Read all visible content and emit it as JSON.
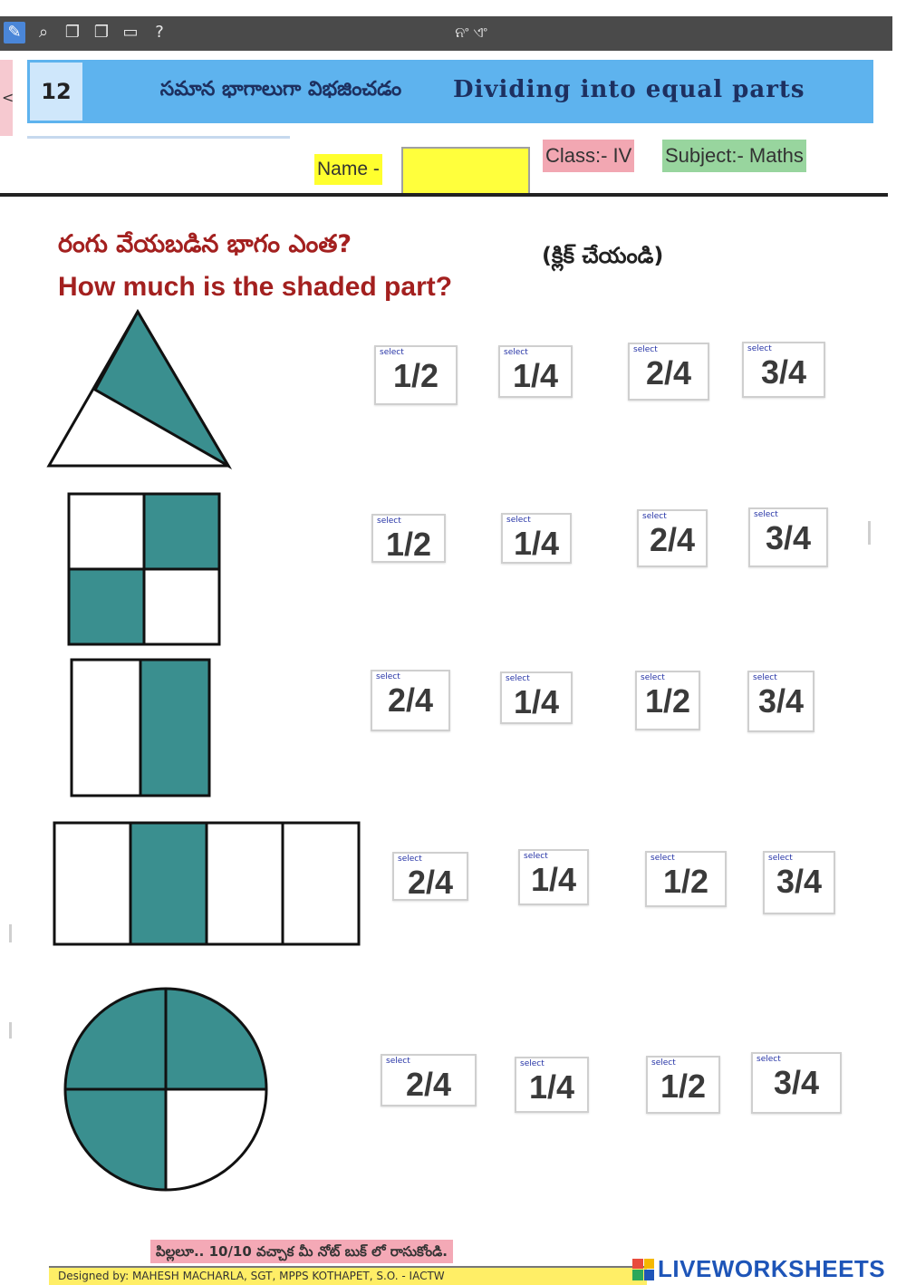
{
  "toolbar": {
    "title": "ନଂ ଏଂ",
    "icons": [
      "edit-icon",
      "zoom-icon",
      "copy-icon",
      "copy-alt-icon",
      "doc-icon",
      "help-icon"
    ]
  },
  "left_tab": "<",
  "banner": {
    "lesson_number": "12",
    "title_te": "సమాన భాగాలుగా విభజించడం",
    "title_en": "Dividing into equal parts"
  },
  "form": {
    "name_label": "Name -",
    "name_value": "",
    "class_label": "Class:- IV",
    "subject_label": "Subject:- Maths"
  },
  "question": {
    "text_te": "రంగు వేయబడిన భాగం ఎంత?",
    "text_en": "How much is the shaded part?",
    "hint_te": "(క్లిక్ చేయండి)"
  },
  "choice_hint": "select",
  "rows": [
    {
      "shape": "triangle",
      "choices": [
        "1/2",
        "1/4",
        "2/4",
        "3/4"
      ]
    },
    {
      "shape": "square-grid",
      "choices": [
        "1/2",
        "1/4",
        "2/4",
        "3/4"
      ]
    },
    {
      "shape": "two-columns",
      "choices": [
        "2/4",
        "1/4",
        "1/2",
        "3/4"
      ]
    },
    {
      "shape": "four-strip",
      "choices": [
        "2/4",
        "1/4",
        "1/2",
        "3/4"
      ]
    },
    {
      "shape": "circle",
      "choices": [
        "2/4",
        "1/4",
        "1/2",
        "3/4"
      ]
    }
  ],
  "colors": {
    "shade": "#3a8f8f",
    "banner": "#5eb3ee",
    "question_text": "#a3201f",
    "name_field": "#ffff3c"
  },
  "footer": {
    "note": "పిల్లలూ.. 10/10 వచ్చాక మీ నోట్ బుక్ లో రాసుకోండి.",
    "credit": "Designed by: MAHESH MACHARLA, SGT, MPPS KOTHAPET, S.O. - IACTW",
    "brand": "LIVEWORKSHEETS"
  }
}
